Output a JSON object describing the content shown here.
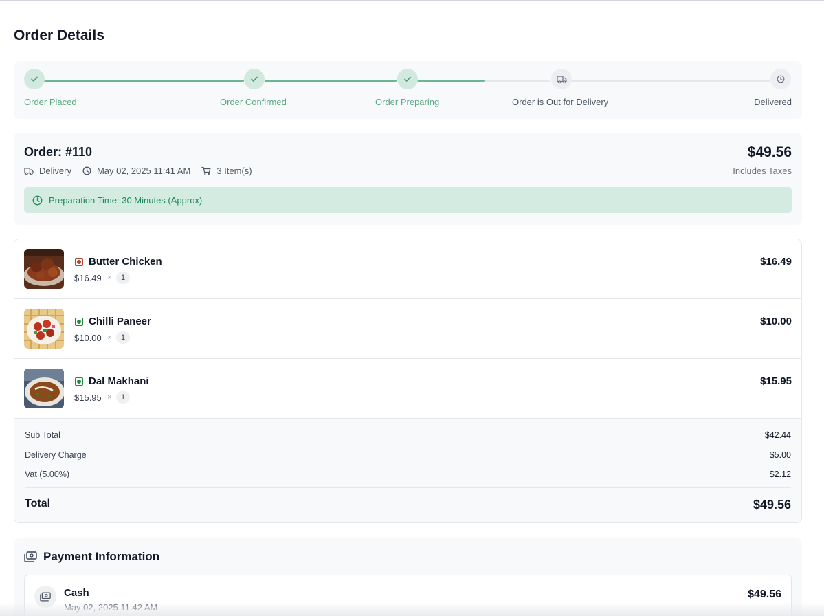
{
  "page": {
    "title": "Order Details"
  },
  "tracker": {
    "steps": [
      {
        "label": "Order Placed",
        "status": "done",
        "icon": "check-icon"
      },
      {
        "label": "Order Confirmed",
        "status": "done",
        "icon": "check-icon"
      },
      {
        "label": "Order Preparing",
        "status": "done",
        "icon": "check-icon"
      },
      {
        "label": "Order is Out for Delivery",
        "status": "pending",
        "icon": "truck-icon"
      },
      {
        "label": "Delivered",
        "status": "pending",
        "icon": "clock-icon"
      }
    ]
  },
  "order": {
    "number": "Order: #110",
    "total": "$49.56",
    "tax_note": "Includes Taxes",
    "type": "Delivery",
    "datetime": "May 02, 2025 11:41 AM",
    "item_count": "3 Item(s)",
    "prep_time": "Preparation Time: 30 Minutes (Approx)"
  },
  "items": [
    {
      "name": "Butter Chicken",
      "price": "$16.49",
      "times": "×",
      "qty": "1",
      "total": "$16.49",
      "veg": false
    },
    {
      "name": "Chilli Paneer",
      "price": "$10.00",
      "times": "×",
      "qty": "1",
      "total": "$10.00",
      "veg": true
    },
    {
      "name": "Dal Makhani",
      "price": "$15.95",
      "times": "×",
      "qty": "1",
      "total": "$15.95",
      "veg": true
    }
  ],
  "summary": {
    "subtotal_label": "Sub Total",
    "subtotal": "$42.44",
    "delivery_label": "Delivery Charge",
    "delivery": "$5.00",
    "vat_label": "Vat (5.00%)",
    "vat": "$2.12",
    "total_label": "Total",
    "total": "$49.56"
  },
  "payment": {
    "title": "Payment Information",
    "method": "Cash",
    "date": "May 02, 2025 11:42 AM",
    "amount": "$49.56"
  },
  "colors": {
    "accent_green": "#5aa886",
    "prep_bg": "#d3ebe1",
    "veg_green": "#1e8a3c",
    "nonveg_red": "#b5432e"
  }
}
